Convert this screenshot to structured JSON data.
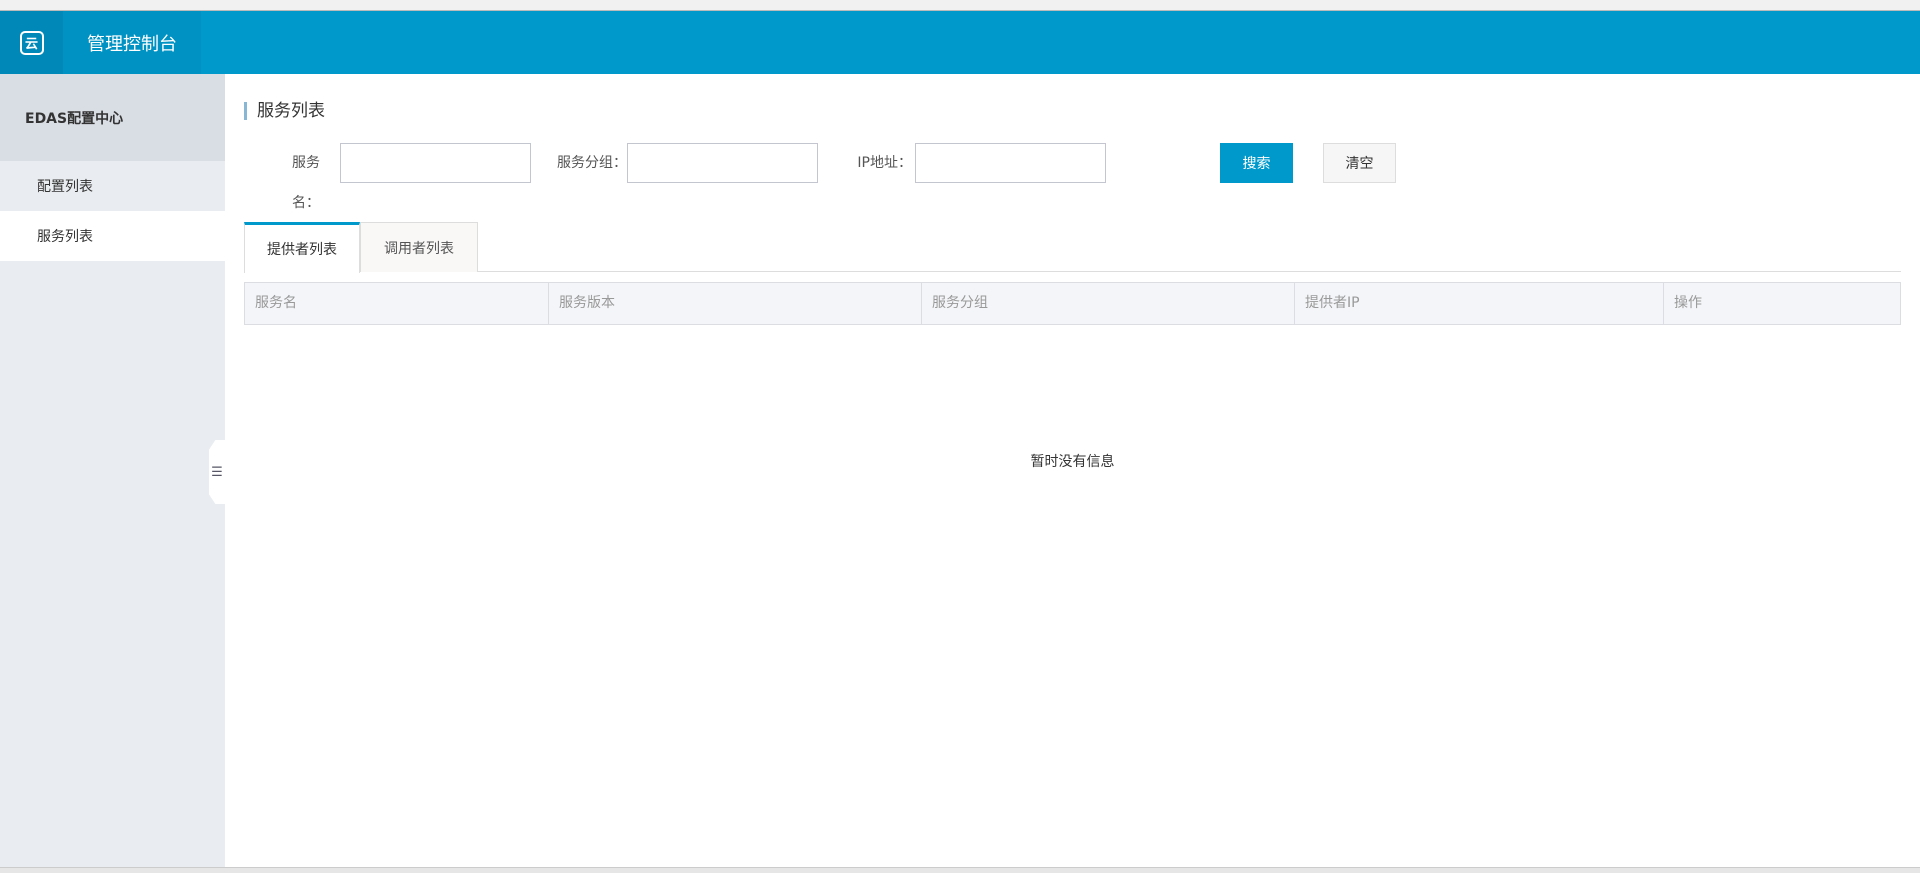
{
  "header": {
    "title": "管理控制台",
    "logo_icon": "cloud-logo-icon",
    "color": "#0099cc"
  },
  "sidebar": {
    "title": "EDAS配置中心",
    "items": [
      {
        "label": "配置列表"
      },
      {
        "label": "服务列表",
        "active": true
      }
    ],
    "collapse_icon": "collapse-icon"
  },
  "main": {
    "title": "服务列表",
    "form": {
      "service_name_label": "服务名：",
      "service_group_label": "服务分组：",
      "ip_label": "IP地址：",
      "service_name_value": "",
      "service_group_value": "",
      "ip_value": ""
    },
    "buttons": {
      "search": "搜索",
      "clear": "清空"
    },
    "tabs": [
      {
        "label": "提供者列表",
        "active": true
      },
      {
        "label": "调用者列表"
      }
    ],
    "table": {
      "columns": [
        "服务名",
        "服务版本",
        "服务分组",
        "提供者IP",
        "操作"
      ],
      "rows": [],
      "empty_text": "暂时没有信息"
    }
  }
}
